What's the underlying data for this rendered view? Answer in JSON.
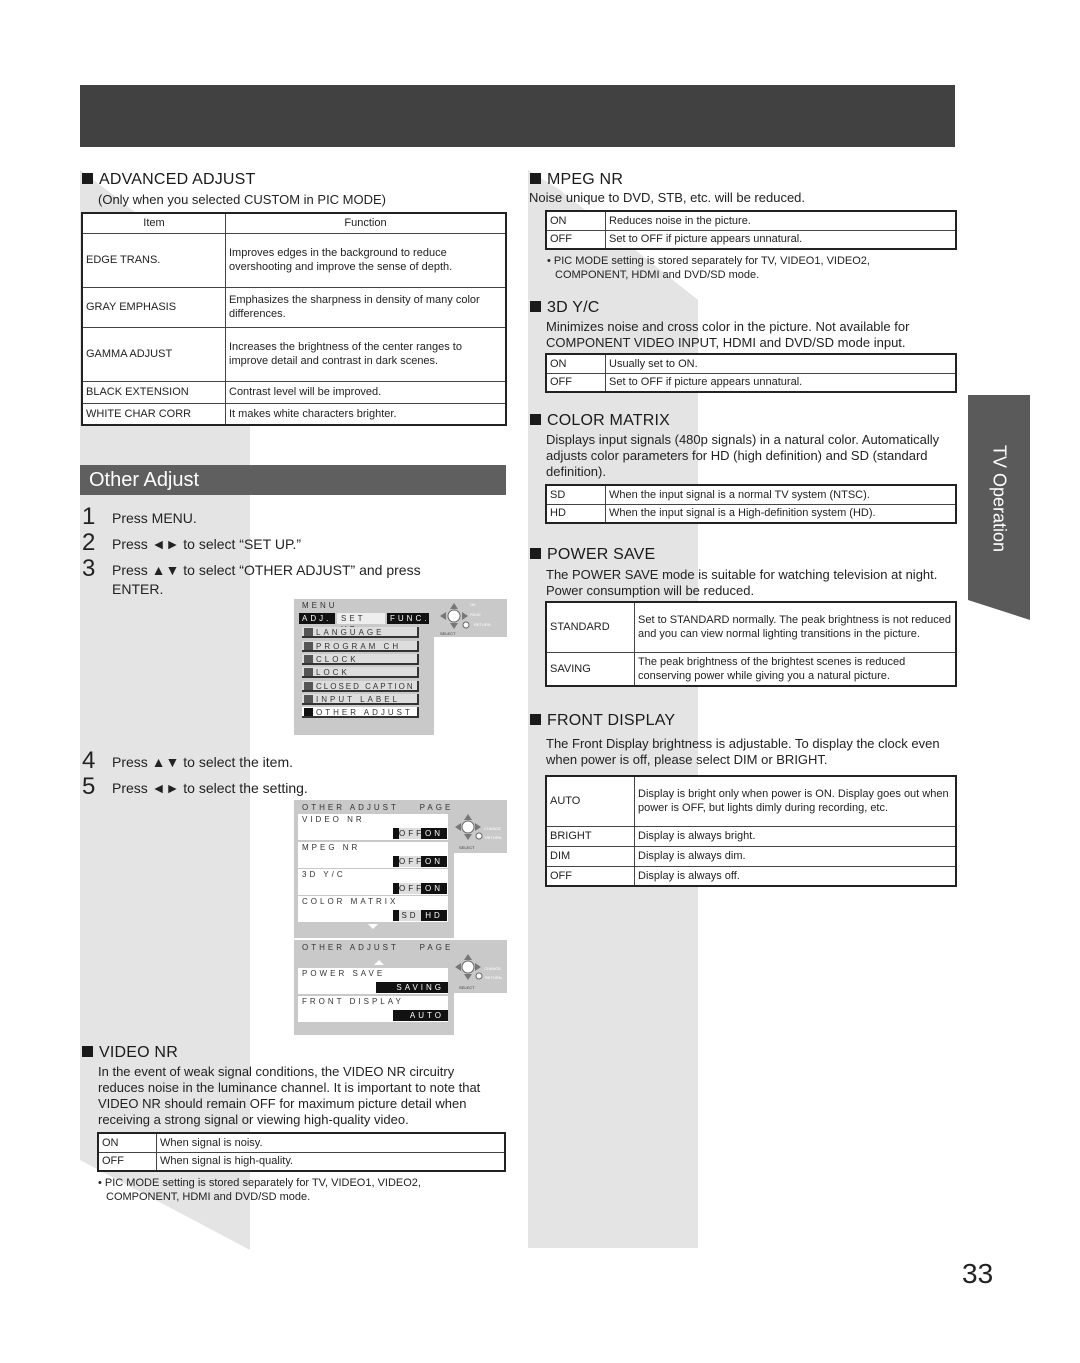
{
  "side_tab": "TV Operation",
  "page_number": "33",
  "advanced_adjust": {
    "title": "ADVANCED ADJUST",
    "subtitle": "(Only when you selected CUSTOM in PIC MODE)",
    "headers": [
      "Item",
      "Function"
    ],
    "rows": [
      {
        "item": "EDGE TRANS.",
        "function": "Improves edges in the background to reduce overshooting and improve the sense of depth."
      },
      {
        "item": "GRAY EMPHASIS",
        "function": "Emphasizes the sharpness in density of many color differences."
      },
      {
        "item": "GAMMA ADJUST",
        "function": "Increases the brightness of the center ranges to improve detail and contrast in dark scenes."
      },
      {
        "item": "BLACK EXTENSION",
        "function": "Contrast level will be improved."
      },
      {
        "item": "WHITE CHAR CORR",
        "function": "It makes white characters brighter."
      }
    ]
  },
  "other_adjust": {
    "title": "Other Adjust",
    "steps": [
      {
        "num": "1",
        "text": "Press MENU."
      },
      {
        "num": "2",
        "text": "Press ◄► to select “SET UP.”"
      },
      {
        "num": "3",
        "text": "Press ▲▼ to select “OTHER ADJUST” and press",
        "text2": "ENTER."
      },
      {
        "num": "4",
        "text": "Press ▲▼ to select the item."
      },
      {
        "num": "5",
        "text": "Press ◄► to select the setting."
      }
    ]
  },
  "osd_menu": {
    "title": "MENU",
    "tabs": [
      "ADJ.",
      "SET UP",
      "FUNC."
    ],
    "items": [
      "LANGUAGE",
      "PROGRAM CH",
      "CLOCK",
      "LOCK",
      "CLOSED CAPTION",
      "INPUT LABEL",
      "OTHER ADJUST"
    ],
    "pad_labels": {
      "ok": "OK",
      "page": "PAGE",
      "return": "RETURN",
      "select": "SELECT"
    }
  },
  "osd_page1": {
    "title": "OTHER ADJUST    PAGE   1/2",
    "items": [
      {
        "label": "VIDEO NR",
        "opt_a": "OFF",
        "opt_b": "ON"
      },
      {
        "label": "MPEG NR",
        "opt_a": "OFF",
        "opt_b": "ON"
      },
      {
        "label": "3D Y/C",
        "opt_a": "OFF",
        "opt_b": "ON"
      },
      {
        "label": "COLOR MATRIX",
        "opt_a": "SD",
        "opt_b": "HD"
      }
    ],
    "pad_labels": {
      "change": "CHANGE",
      "return": "RETURN",
      "select": "SELECT"
    }
  },
  "osd_page2": {
    "title": "OTHER ADJUST    PAGE   2/2",
    "items": [
      {
        "label": "POWER SAVE",
        "value": "SAVING"
      },
      {
        "label": "FRONT DISPLAY",
        "value": "AUTO"
      }
    ],
    "pad_labels": {
      "change": "CHANGE",
      "return": "RETURN",
      "select": "SELECT"
    }
  },
  "video_nr": {
    "title": "VIDEO NR",
    "desc": "In the event of weak signal conditions, the VIDEO NR circuitry reduces noise in the luminance channel. It is important to note that VIDEO NR should remain OFF for maximum picture detail when receiving a strong signal or viewing high-quality video.",
    "rows": [
      {
        "k": "ON",
        "v": "When signal is noisy."
      },
      {
        "k": "OFF",
        "v": "When signal is high-quality."
      }
    ],
    "note": "• PIC MODE setting is stored separately for TV, VIDEO1, VIDEO2, COMPONENT, HDMI and DVD/SD mode."
  },
  "mpeg_nr": {
    "title": "MPEG NR",
    "desc": "Noise unique to DVD, STB, etc. will be reduced.",
    "rows": [
      {
        "k": "ON",
        "v": "Reduces noise in the picture."
      },
      {
        "k": "OFF",
        "v": "Set to OFF if picture appears unnatural."
      }
    ],
    "note": "• PIC MODE setting is stored separately for TV, VIDEO1, VIDEO2, COMPONENT, HDMI and DVD/SD mode."
  },
  "yc3d": {
    "title": "3D Y/C",
    "desc": "Minimizes noise and cross color in the picture. Not available for COMPONENT VIDEO INPUT, HDMI and DVD/SD mode input.",
    "rows": [
      {
        "k": "ON",
        "v": "Usually set to ON."
      },
      {
        "k": "OFF",
        "v": "Set to OFF if picture appears unnatural."
      }
    ]
  },
  "color_matrix": {
    "title": "COLOR MATRIX",
    "desc": "Displays input signals (480p signals) in a natural color. Automatically adjusts color parameters for HD (high definition) and SD (standard definition).",
    "rows": [
      {
        "k": "SD",
        "v": "When the input signal is a normal TV system (NTSC)."
      },
      {
        "k": "HD",
        "v": "When the input signal is a High-definition system (HD)."
      }
    ]
  },
  "power_save": {
    "title": "POWER SAVE",
    "desc": "The POWER SAVE mode is suitable for watching television at night. Power consumption will be reduced.",
    "rows": [
      {
        "k": "STANDARD",
        "v": "Set to STANDARD normally. The peak brightness is not reduced and you can view normal lighting transitions in the picture."
      },
      {
        "k": "SAVING",
        "v": "The peak brightness of the brightest scenes is reduced conserving power while giving you a natural picture."
      }
    ]
  },
  "front_display": {
    "title": "FRONT DISPLAY",
    "desc": "The Front Display brightness is adjustable. To display the clock even when power is off, please select DIM or BRIGHT.",
    "rows": [
      {
        "k": "AUTO",
        "v": "Display is bright only when power is ON. Display goes out when power is OFF, but lights dimly during recording, etc."
      },
      {
        "k": "BRIGHT",
        "v": "Display is always bright."
      },
      {
        "k": "DIM",
        "v": "Display is always dim."
      },
      {
        "k": "OFF",
        "v": "Display is always off."
      }
    ]
  }
}
